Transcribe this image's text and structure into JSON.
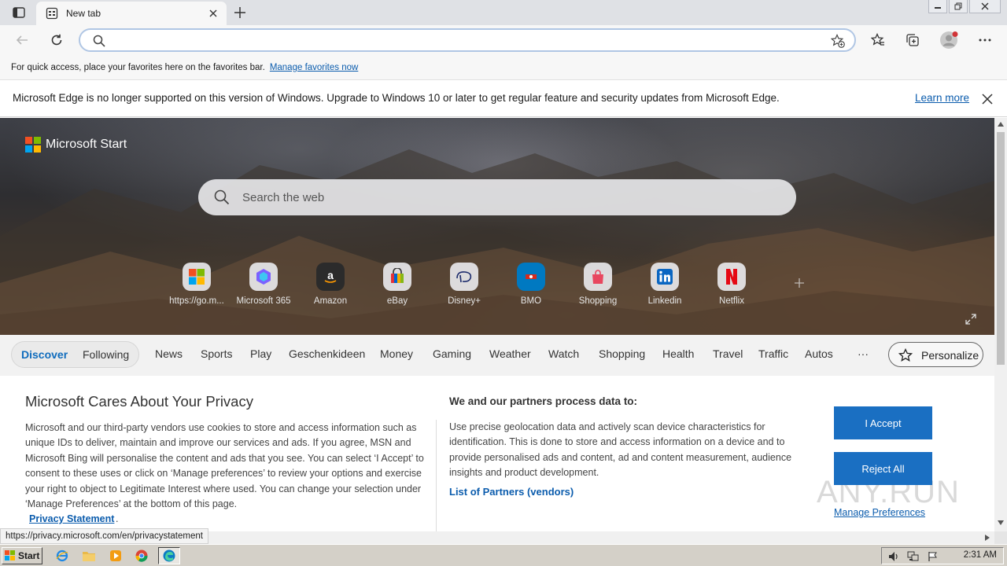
{
  "browser": {
    "tab_title": "New tab",
    "address_value": "",
    "favorites_bar_text": "For quick access, place your favorites here on the favorites bar.",
    "favorites_bar_link": "Manage favorites now"
  },
  "infobar": {
    "message": "Microsoft Edge is no longer supported on this version of Windows. Upgrade to Windows 10 or later to get regular feature and security updates from Microsoft Edge.",
    "link": "Learn more"
  },
  "hero": {
    "brand": "Microsoft Start",
    "search_placeholder": "Search the web",
    "quick_links": [
      {
        "label": "https://go.m...",
        "icon": "windows-icon"
      },
      {
        "label": "Microsoft 365",
        "icon": "microsoft365-icon"
      },
      {
        "label": "Amazon",
        "icon": "amazon-icon"
      },
      {
        "label": "eBay",
        "icon": "ebay-icon"
      },
      {
        "label": "Disney+",
        "icon": "disney-icon"
      },
      {
        "label": "BMO",
        "icon": "bmo-icon"
      },
      {
        "label": "Shopping",
        "icon": "shopping-bag-icon"
      },
      {
        "label": "Linkedin",
        "icon": "linkedin-icon"
      },
      {
        "label": "Netflix",
        "icon": "netflix-icon"
      }
    ]
  },
  "feed_nav": {
    "discover": "Discover",
    "following": "Following",
    "items": [
      "News",
      "Sports",
      "Play",
      "Geschenkideen",
      "Money",
      "Gaming",
      "Weather",
      "Watch",
      "Shopping",
      "Health",
      "Travel",
      "Traffic",
      "Autos"
    ],
    "more": "···",
    "personalize": "Personalize"
  },
  "privacy": {
    "title": "Microsoft Cares About Your Privacy",
    "body": "Microsoft and our third-party vendors use cookies to store and access information such as unique IDs to deliver, maintain and improve our services and ads. If you agree, MSN and Microsoft Bing will personalise the content and ads that you see. You can select ‘I Accept’ to consent to these uses or click on ‘Manage preferences’ to review your options and exercise your right to object to Legitimate Interest where used.  You can change your selection under ‘Manage Preferences’ at the bottom of this page.",
    "statement_link": "Privacy Statement",
    "statement_dot": ".",
    "partners_title": "We and our partners process data to:",
    "partners_body": "Use precise geolocation data and actively scan device characteristics for identification. This is done to store and access information on a device and to provide personalised ads and content, ad and content measurement, audience insights and product development.",
    "partners_link": "List of Partners (vendors)",
    "accept": "I Accept",
    "reject": "Reject All",
    "manage": "Manage Preferences",
    "watermark": "ANY.RUN"
  },
  "status_url": "https://privacy.microsoft.com/en/privacystatement",
  "taskbar": {
    "start": "Start",
    "clock": "2:31 AM"
  },
  "colors": {
    "accent": "#1a6fc2",
    "link": "#0b5cad",
    "discover": "#0f6cbd"
  }
}
